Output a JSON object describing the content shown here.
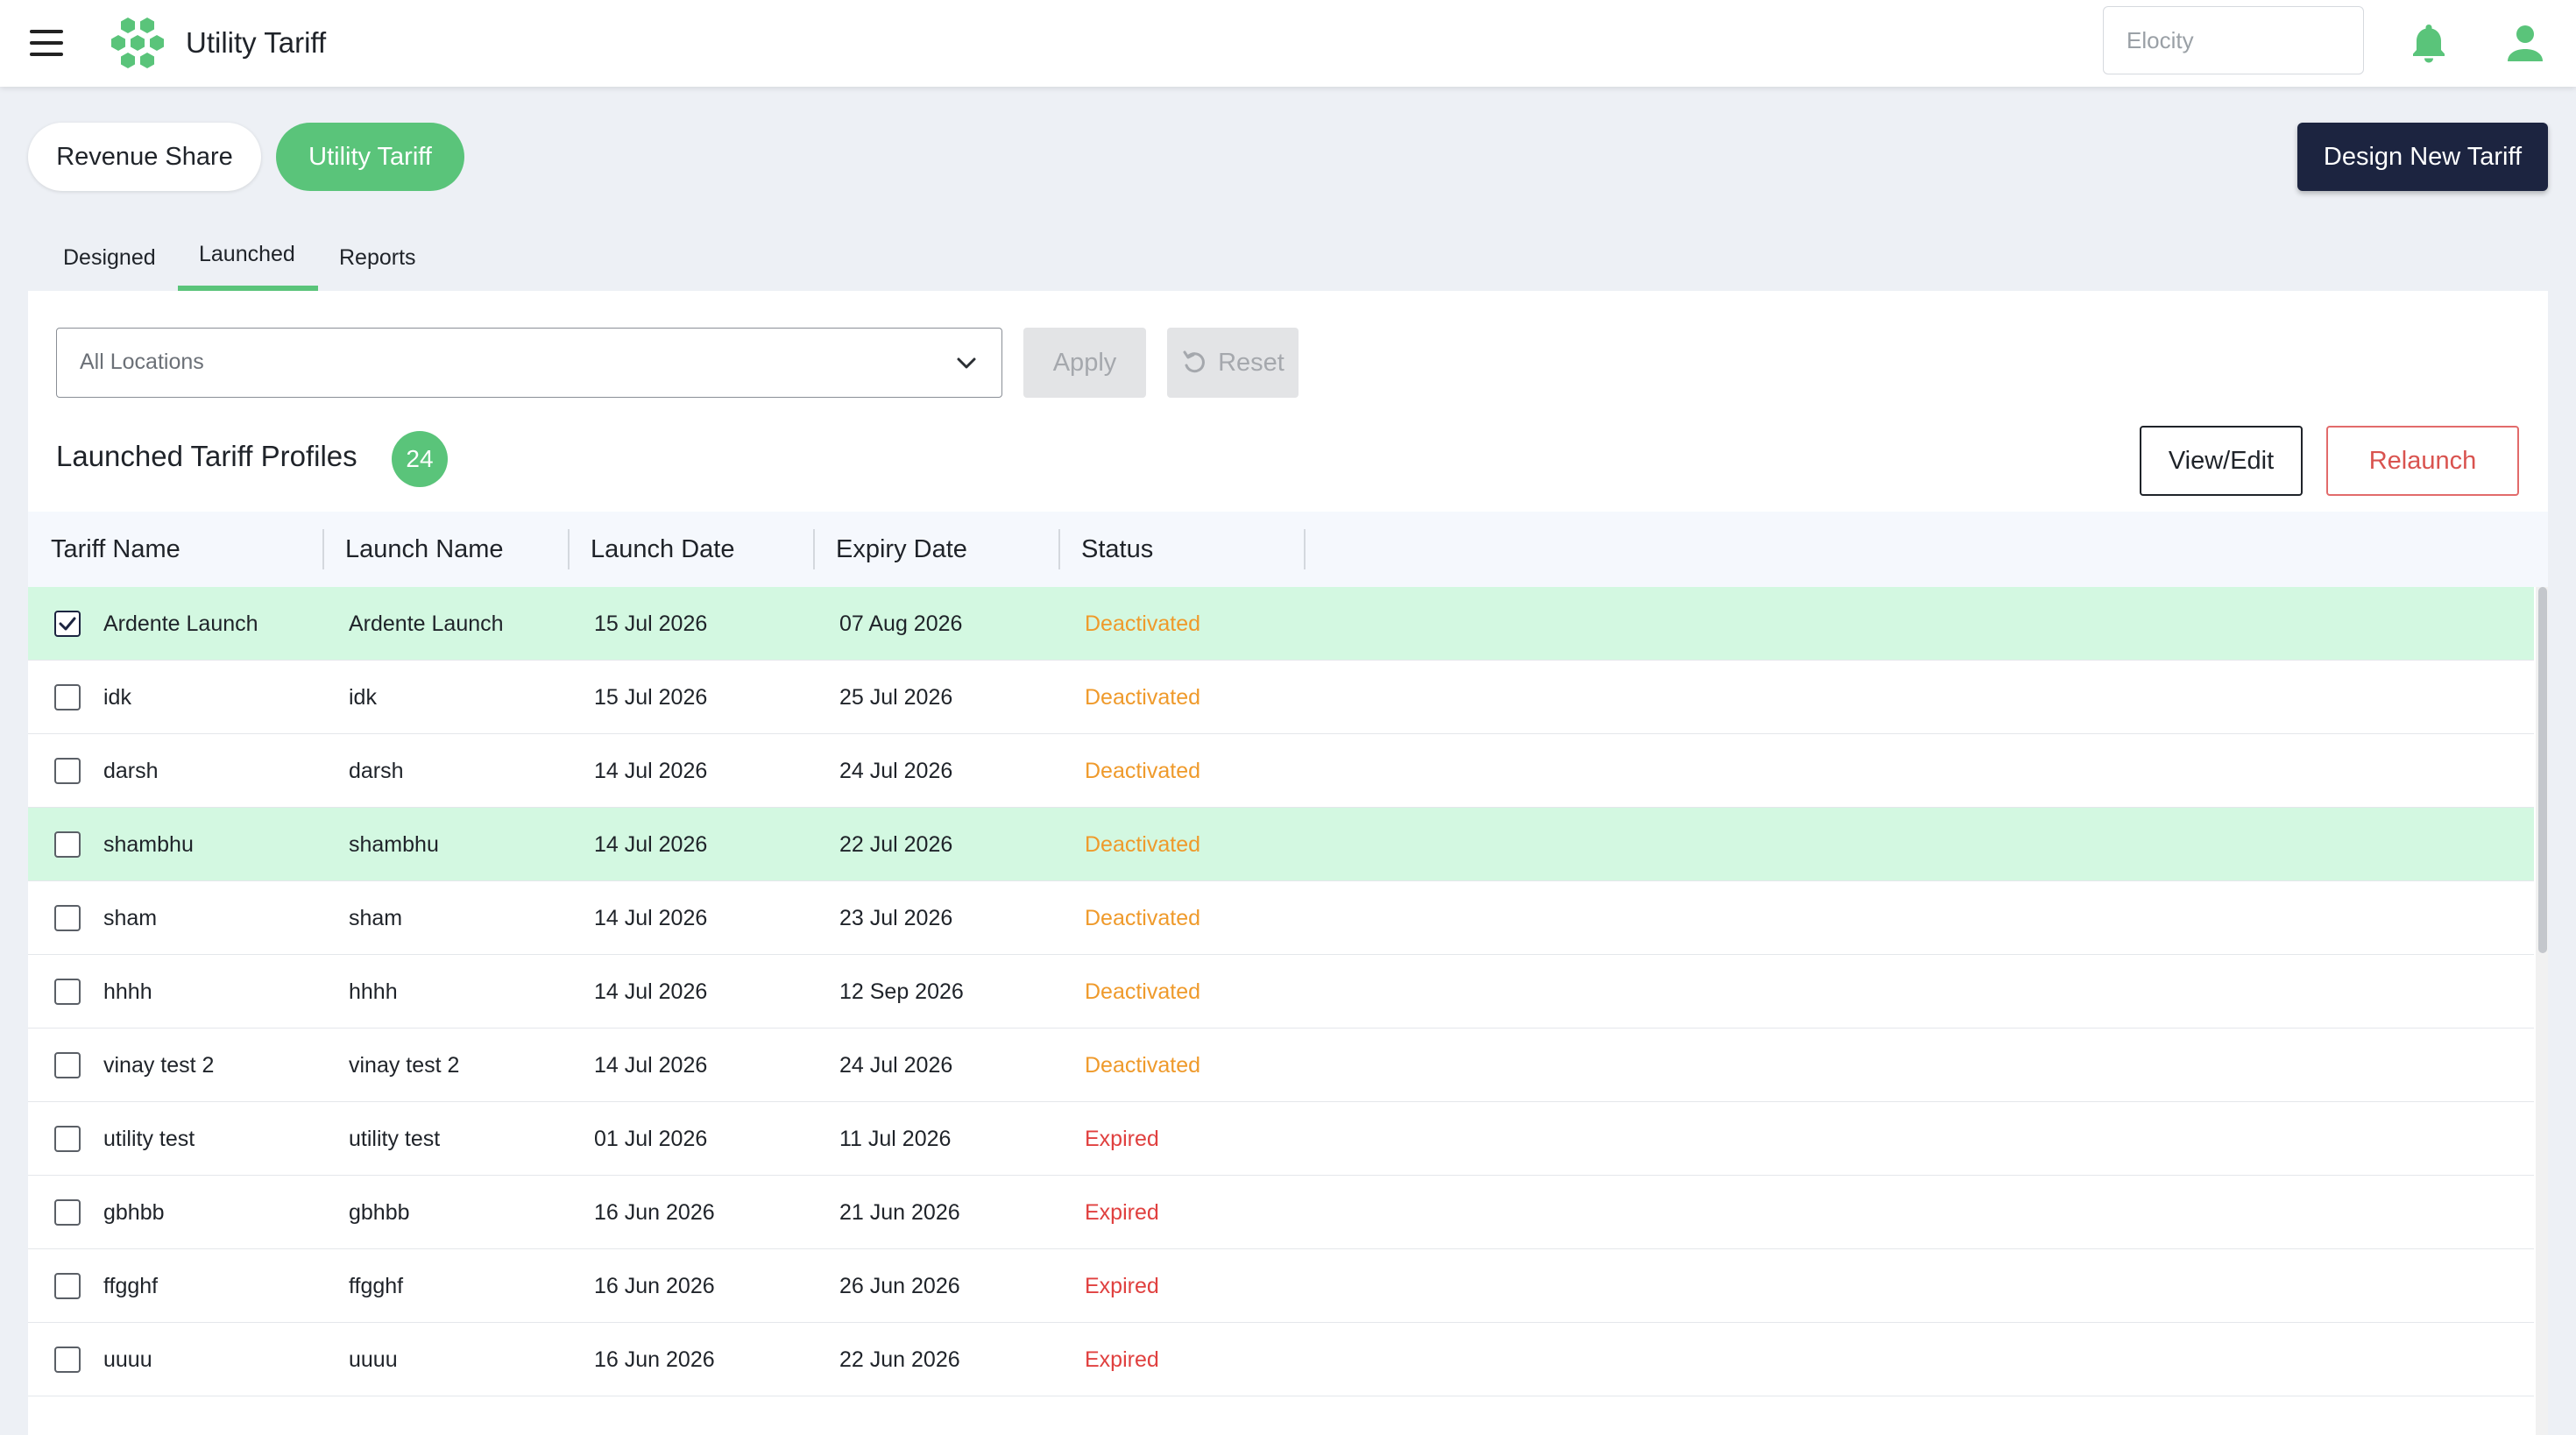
{
  "header": {
    "app_title": "Utility Tariff",
    "tenant_placeholder": "Elocity",
    "brand_color": "#5ac47a",
    "icons": {
      "menu": "hamburger-icon",
      "logo": "hexagon-cluster-logo",
      "bell": "bell-icon",
      "user": "user-icon"
    }
  },
  "modes": {
    "revenue_share": "Revenue Share",
    "utility_tariff": "Utility Tariff"
  },
  "design_button": "Design New Tariff",
  "tabs": [
    {
      "label": "Designed",
      "active": false
    },
    {
      "label": "Launched",
      "active": true
    },
    {
      "label": "Reports",
      "active": false
    }
  ],
  "filters": {
    "location_value": "All Locations",
    "apply_label": "Apply",
    "reset_label": "Reset"
  },
  "list": {
    "title": "Launched Tariff Profiles",
    "count": "24",
    "view_edit_label": "View/Edit",
    "relaunch_label": "Relaunch"
  },
  "table": {
    "columns": [
      "Tariff Name",
      "Launch Name",
      "Launch Date",
      "Expiry Date",
      "Status"
    ],
    "rows": [
      {
        "tariff": "Ardente Launch",
        "launch": "Ardente Launch",
        "launch_date": "15 Jul 2026",
        "expiry_date": "07 Aug 2026",
        "status": "Deactivated",
        "checked": true,
        "highlighted": true
      },
      {
        "tariff": "idk",
        "launch": "idk",
        "launch_date": "15 Jul 2026",
        "expiry_date": "25 Jul 2026",
        "status": "Deactivated",
        "checked": false,
        "highlighted": false
      },
      {
        "tariff": "darsh",
        "launch": "darsh",
        "launch_date": "14 Jul 2026",
        "expiry_date": "24 Jul 2026",
        "status": "Deactivated",
        "checked": false,
        "highlighted": false
      },
      {
        "tariff": "shambhu",
        "launch": "shambhu",
        "launch_date": "14 Jul 2026",
        "expiry_date": "22 Jul 2026",
        "status": "Deactivated",
        "checked": false,
        "highlighted": true
      },
      {
        "tariff": "sham",
        "launch": "sham",
        "launch_date": "14 Jul 2026",
        "expiry_date": "23 Jul 2026",
        "status": "Deactivated",
        "checked": false,
        "highlighted": false
      },
      {
        "tariff": "hhhh",
        "launch": "hhhh",
        "launch_date": "14 Jul 2026",
        "expiry_date": "12 Sep 2026",
        "status": "Deactivated",
        "checked": false,
        "highlighted": false
      },
      {
        "tariff": "vinay test 2",
        "launch": "vinay test 2",
        "launch_date": "14 Jul 2026",
        "expiry_date": "24 Jul 2026",
        "status": "Deactivated",
        "checked": false,
        "highlighted": false
      },
      {
        "tariff": "utility test",
        "launch": "utility test",
        "launch_date": "01 Jul 2026",
        "expiry_date": "11 Jul 2026",
        "status": "Expired",
        "checked": false,
        "highlighted": false
      },
      {
        "tariff": "gbhbb",
        "launch": "gbhbb",
        "launch_date": "16 Jun 2026",
        "expiry_date": "21 Jun 2026",
        "status": "Expired",
        "checked": false,
        "highlighted": false
      },
      {
        "tariff": "ffgghf",
        "launch": "ffgghf",
        "launch_date": "16 Jun 2026",
        "expiry_date": "26 Jun 2026",
        "status": "Expired",
        "checked": false,
        "highlighted": false
      },
      {
        "tariff": "uuuu",
        "launch": "uuuu",
        "launch_date": "16 Jun 2026",
        "expiry_date": "22 Jun 2026",
        "status": "Expired",
        "checked": false,
        "highlighted": false
      }
    ]
  },
  "status_colors": {
    "Deactivated": "#ef9a2b",
    "Expired": "#e0403f"
  }
}
